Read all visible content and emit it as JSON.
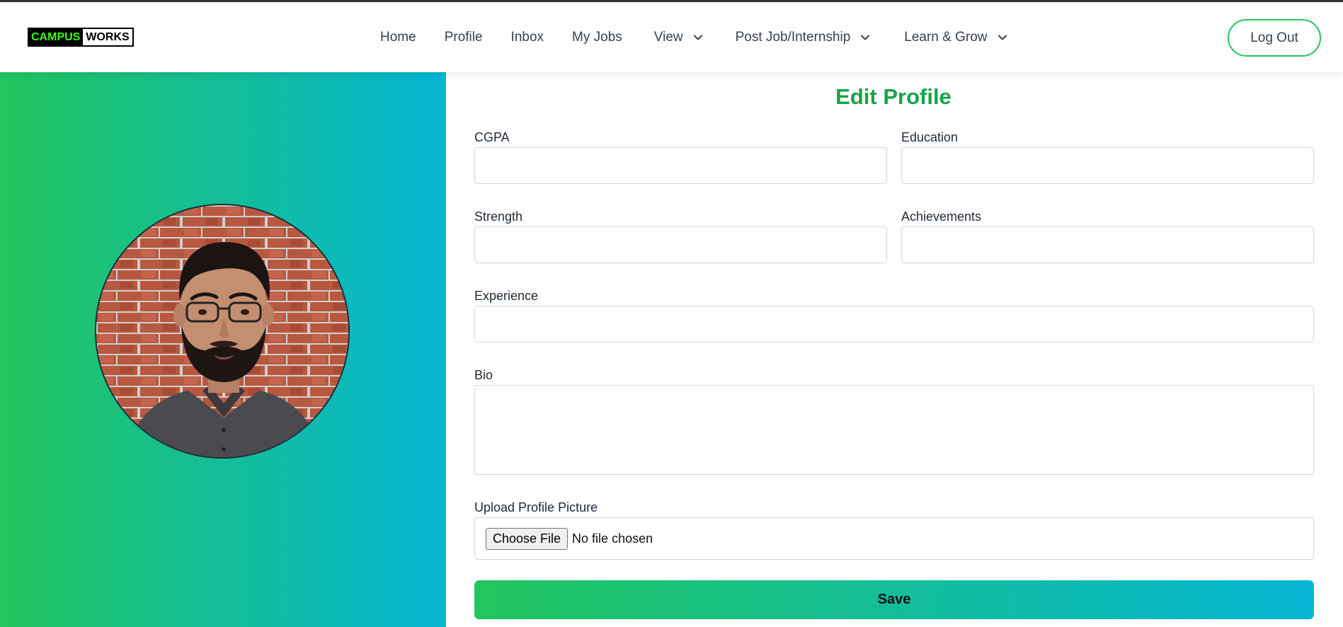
{
  "brand": {
    "part1": "CAMPUS",
    "part2": "WORKS",
    "accent": "#39ff14"
  },
  "nav": {
    "items": [
      {
        "label": "Home",
        "dropdown": false
      },
      {
        "label": "Profile",
        "dropdown": false
      },
      {
        "label": "Inbox",
        "dropdown": false
      },
      {
        "label": "My Jobs",
        "dropdown": false
      },
      {
        "label": "View",
        "dropdown": true
      },
      {
        "label": "Post Job/Internship",
        "dropdown": true
      },
      {
        "label": "Learn & Grow",
        "dropdown": true
      }
    ],
    "logout_label": "Log Out"
  },
  "theme": {
    "gradient_start": "#22c55e",
    "gradient_end": "#06b6d4",
    "title_color": "#16a34a"
  },
  "form": {
    "title": "Edit Profile",
    "cgpa": {
      "label": "CGPA",
      "value": ""
    },
    "education": {
      "label": "Education",
      "value": ""
    },
    "strength": {
      "label": "Strength",
      "value": ""
    },
    "achievements": {
      "label": "Achievements",
      "value": ""
    },
    "experience": {
      "label": "Experience",
      "value": ""
    },
    "bio": {
      "label": "Bio",
      "value": ""
    },
    "upload": {
      "label": "Upload Profile Picture",
      "button_label": "Choose File",
      "status": "No file chosen"
    },
    "save_label": "Save"
  },
  "profile_photo": {
    "icon": "profile-photo"
  }
}
